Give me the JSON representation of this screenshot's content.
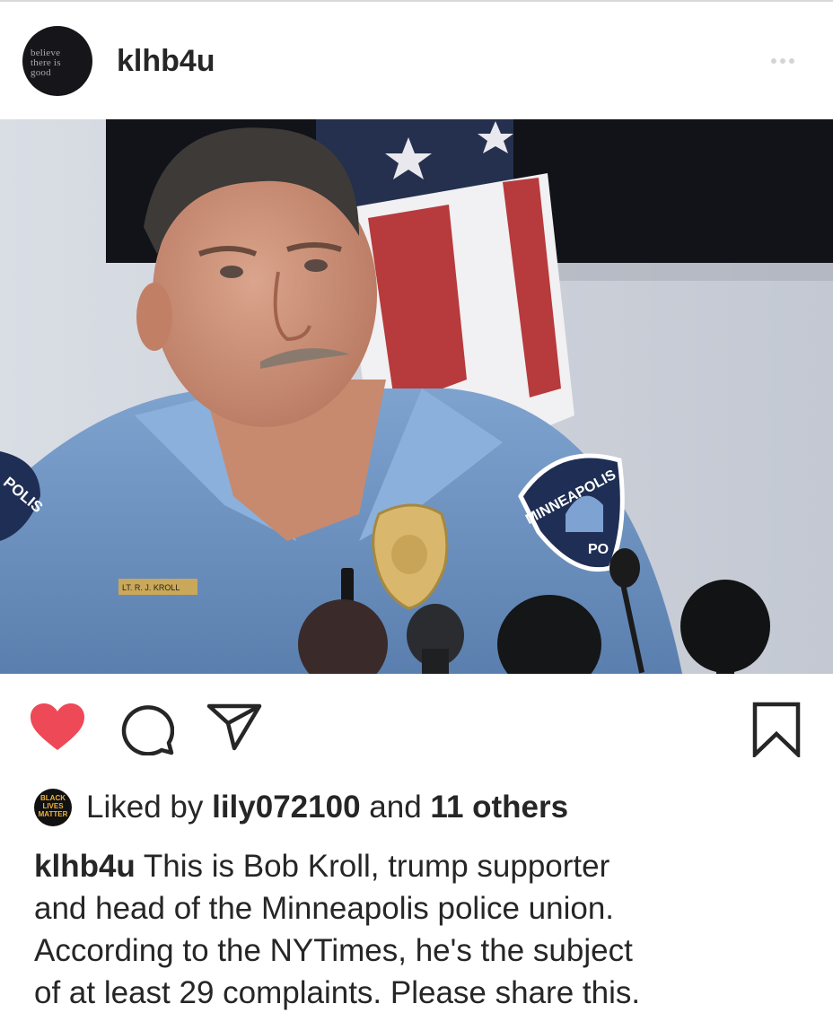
{
  "header": {
    "username": "klhb4u",
    "avatar_text": [
      "believe",
      "there is",
      "good"
    ]
  },
  "post": {
    "image_text": {
      "name_tag": "LT. R. J. KROLL",
      "patch_left": "POLIS",
      "patch_right": "MINNEAPOLIS",
      "patch_right_bottom": "PO"
    }
  },
  "actions": {
    "like_icon": "heart-filled-icon",
    "comment_icon": "comment-icon",
    "share_icon": "paper-plane-icon",
    "save_icon": "bookmark-icon",
    "like_color": "#ed4956"
  },
  "likes": {
    "liker_avatar_text": [
      "BLACK",
      "LIVES",
      "MATTER"
    ],
    "prefix": "Liked by",
    "user": "lily072100",
    "connector": "and",
    "others": "11 others"
  },
  "caption": {
    "username": "klhb4u",
    "lines": [
      "This is Bob Kroll, trump supporter",
      "and head of the Minneapolis police union.",
      "According to the NYTimes, he's the subject",
      "of at least 29 complaints. Please share this."
    ]
  }
}
